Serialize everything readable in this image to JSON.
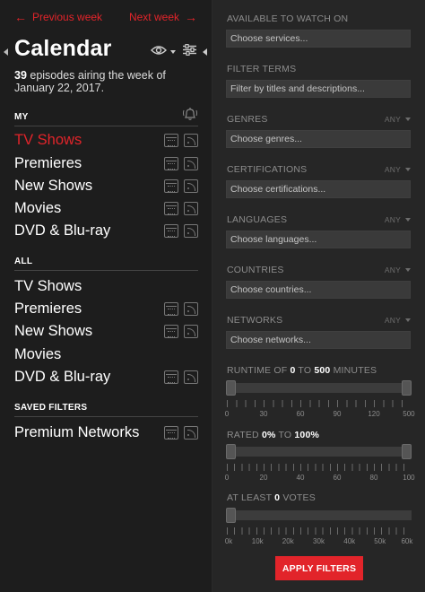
{
  "nav": {
    "prev_label": "Previous week",
    "next_label": "Next week",
    "prev_arrow": "←",
    "next_arrow": "→"
  },
  "header": {
    "title": "Calendar",
    "episode_count": "39",
    "summary_text": " episodes airing the week of January 22, 2017."
  },
  "sections": {
    "my": {
      "title": "MY",
      "items": [
        {
          "label": "TV Shows",
          "active": true
        },
        {
          "label": "Premieres"
        },
        {
          "label": "New Shows"
        },
        {
          "label": "Movies"
        },
        {
          "label": "DVD & Blu-ray"
        }
      ]
    },
    "all": {
      "title": "ALL",
      "items": [
        {
          "label": "TV Shows"
        },
        {
          "label": "Premieres"
        },
        {
          "label": "New Shows"
        },
        {
          "label": "Movies"
        },
        {
          "label": "DVD & Blu-ray"
        }
      ]
    },
    "saved": {
      "title": "SAVED FILTERS",
      "items": [
        {
          "label": "Premium Networks"
        }
      ]
    }
  },
  "filters": {
    "available": {
      "label": "AVAILABLE TO WATCH ON",
      "placeholder": "Choose services..."
    },
    "terms": {
      "label": "FILTER TERMS",
      "placeholder": "Filter by titles and descriptions..."
    },
    "genres": {
      "label": "GENRES",
      "any": "ANY",
      "placeholder": "Choose genres..."
    },
    "certifications": {
      "label": "CERTIFICATIONS",
      "any": "ANY",
      "placeholder": "Choose certifications..."
    },
    "languages": {
      "label": "LANGUAGES",
      "any": "ANY",
      "placeholder": "Choose languages..."
    },
    "countries": {
      "label": "COUNTRIES",
      "any": "ANY",
      "placeholder": "Choose countries..."
    },
    "networks": {
      "label": "NETWORKS",
      "any": "ANY",
      "placeholder": "Choose networks..."
    }
  },
  "runtime": {
    "prefix": "RUNTIME OF ",
    "min": "0",
    "mid": " TO ",
    "max": "500",
    "suffix": " MINUTES",
    "ticks": [
      "0",
      "30",
      "60",
      "90",
      "120",
      "150",
      "180",
      "210",
      "240",
      "270",
      "300",
      "330",
      "360",
      "390",
      "420",
      "450",
      "480",
      "500"
    ],
    "shown_ticks": [
      "0",
      "30",
      "60",
      "90",
      "120",
      "150",
      "180",
      "500"
    ],
    "value_min_fraction": 0,
    "value_max_fraction": 1
  },
  "rated": {
    "prefix": "RATED ",
    "min": "0%",
    "mid": " TO ",
    "max": "100%",
    "shown_ticks": [
      "0",
      "20",
      "40",
      "60",
      "80",
      "100"
    ],
    "value_min_fraction": 0,
    "value_max_fraction": 1
  },
  "votes": {
    "prefix": "AT LEAST ",
    "value": "0",
    "suffix": " VOTES",
    "shown_ticks": [
      "0k",
      "10k",
      "20k",
      "30k",
      "40k",
      "50k",
      "60k"
    ],
    "value_fraction": 0
  },
  "apply_label": "APPLY FILTERS",
  "colors": {
    "accent": "#e2242a",
    "left_bg": "#1d1d1d",
    "right_bg": "#262626"
  }
}
